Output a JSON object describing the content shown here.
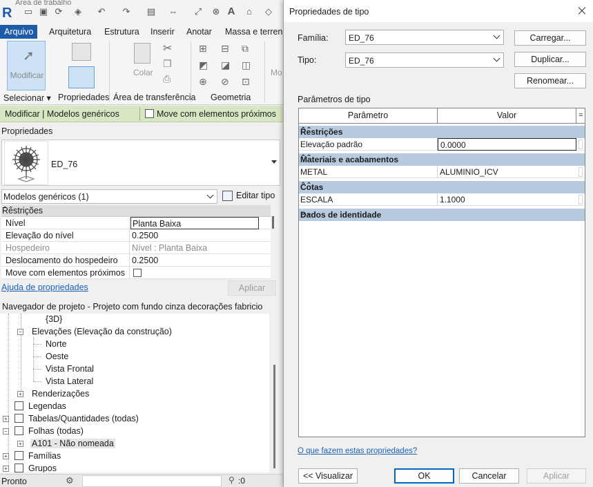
{
  "app": {
    "window_title": "Área de trabalho",
    "logo": "R"
  },
  "ribbon": {
    "tabs": [
      "Arquivo",
      "Arquitetura",
      "Estrutura",
      "Inserir",
      "Anotar",
      "Massa e terreno"
    ],
    "modify_label": "Modificar",
    "copy_label": "Colar",
    "groups": [
      "Selecionar",
      "Propriedades",
      "Área de transferência",
      "Geometria"
    ],
    "cut_label": "Mo"
  },
  "context_bar": {
    "title": "Modificar | Modelos genéricos",
    "move_label": "Move com elementos próximos"
  },
  "properties": {
    "header": "Propriedades",
    "type_name": "ED_76",
    "filter": "Modelos genéricos (1)",
    "edit_type_label": "Editar tipo",
    "category": "Restrições",
    "rows": [
      {
        "key": "Nível",
        "value": "Planta Baixa"
      },
      {
        "key": "Elevação do nível",
        "value": "0.2500"
      },
      {
        "key": "Hospedeiro",
        "value": "Nível : Planta Baixa"
      },
      {
        "key": "Deslocamento do hospedeiro",
        "value": "0.2500"
      },
      {
        "key": "Move com elementos próximos",
        "value": ""
      }
    ],
    "help_link": "Ajuda de propriedades",
    "apply_label": "Aplicar"
  },
  "navigator": {
    "header": "Navegador de projeto - Projeto com fundo cinza decorações fabricio",
    "items": [
      {
        "label": "{3D}"
      },
      {
        "label": "Elevações (Elevação da construção)"
      },
      {
        "label": "Norte"
      },
      {
        "label": "Oeste"
      },
      {
        "label": "Vista Frontal"
      },
      {
        "label": "Vista Lateral"
      },
      {
        "label": "Renderizações"
      },
      {
        "label": "Legendas"
      },
      {
        "label": "Tabelas/Quantidades (todas)"
      },
      {
        "label": "Folhas (todas)"
      },
      {
        "label": "A101 - Não nomeada"
      },
      {
        "label": "Famílias"
      },
      {
        "label": "Grupos"
      }
    ]
  },
  "status_bar": {
    "text": "Pronto",
    "zoom": ":0"
  },
  "dialog": {
    "title": "Propriedades de tipo",
    "family_label": "Família:",
    "family_value": "ED_76",
    "type_label": "Tipo:",
    "type_value": "ED_76",
    "load_label": "Carregar...",
    "duplicate_label": "Duplicar...",
    "rename_label": "Renomear...",
    "params_label": "Parâmetros de tipo",
    "col_param": "Parâmetro",
    "col_value": "Valor",
    "col_extra": "=",
    "groups": [
      {
        "name": "Restrições",
        "rows": [
          {
            "key": "Elevação padrão",
            "value": "0.0000"
          }
        ]
      },
      {
        "name": "Materiais e acabamentos",
        "rows": [
          {
            "key": "METAL",
            "value": "ALUMINIO_ICV"
          }
        ]
      },
      {
        "name": "Cotas",
        "rows": [
          {
            "key": "ESCALA",
            "value": "1.1000"
          }
        ]
      },
      {
        "name": "Dados de identidade",
        "rows": []
      }
    ],
    "what_link": "O que fazem estas propriedades?",
    "preview_label": "<< Visualizar",
    "ok_label": "OK",
    "cancel_label": "Cancelar",
    "apply_label": "Aplicar"
  },
  "colors": {
    "accent": "#1d5aa8",
    "context_bar": "#d7e7c3",
    "grid_category": "#b7cadf",
    "link": "#1a62b8"
  }
}
